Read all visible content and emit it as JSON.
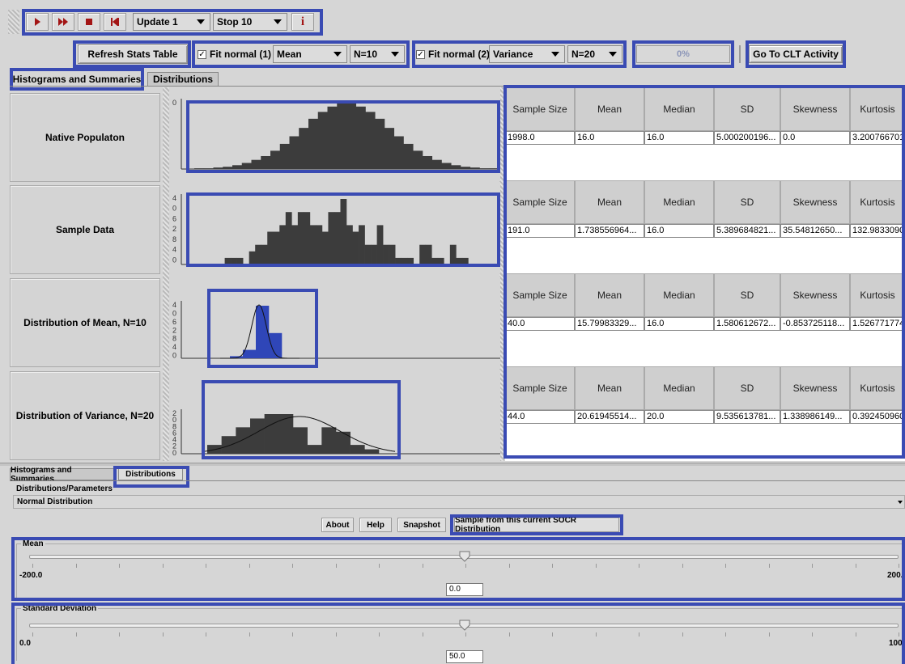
{
  "toolbar": {
    "update_combo": "Update 1",
    "stop_combo": "Stop 10",
    "info_label": "i",
    "refresh_label": "Refresh Stats Table",
    "fit1_label": "Fit normal (1)",
    "fit1_stat": "Mean",
    "fit1_n": "N=10",
    "fit2_label": "Fit normal (2)",
    "fit2_stat": "Variance",
    "fit2_n": "N=20",
    "progress_text": "0%",
    "progress_value": 0,
    "clt_label": "Go To CLT Activity"
  },
  "tabs": {
    "histograms": "Histograms and Summaries",
    "distributions": "Distributions"
  },
  "rows": [
    {
      "label": "Native Populaton"
    },
    {
      "label": "Sample Data"
    },
    {
      "label": "Distribution of Mean, N=10"
    },
    {
      "label": "Distribution of Variance, N=20"
    }
  ],
  "axis_ticks": {
    "row1": [
      "0"
    ],
    "row2": [
      "4",
      "0",
      "6",
      "2",
      "8",
      "4",
      "0"
    ],
    "row3": [
      "4",
      "0",
      "6",
      "2",
      "8",
      "4",
      "0"
    ],
    "row4": [
      "2",
      "0",
      "8",
      "6",
      "4",
      "2",
      "0"
    ]
  },
  "stats": {
    "headers": [
      "Sample Size",
      "Mean",
      "Median",
      "SD",
      "Skewness",
      "Kurtosis"
    ],
    "rows": [
      [
        "1998.0",
        "16.0",
        "16.0",
        "5.000200196...",
        "0.0",
        "3.200766701"
      ],
      [
        "191.0",
        "1.738556964...",
        "16.0",
        "5.389684821...",
        "35.54812650...",
        "132.9833090"
      ],
      [
        "40.0",
        "15.79983329...",
        "16.0",
        "1.580612672...",
        "-0.853725118...",
        "1.526771774"
      ],
      [
        "44.0",
        "20.61945514...",
        "20.0",
        "9.535613781...",
        "1.338986149...",
        "0.392450960"
      ]
    ]
  },
  "bottom": {
    "tab_histograms": "Histograms and Summaries",
    "tab_distributions": "Distributions",
    "params_label": "Distributions/Parameters",
    "dist_select": "Normal Distribution",
    "about": "About",
    "help": "Help",
    "snapshot": "Snapshot",
    "sample_btn": "Sample from this current SOCR Distribution",
    "mean_label": "Mean",
    "mean_min": "-200.0",
    "mean_max": "200.",
    "mean_value": "0.0",
    "sd_label": "Standard Deviation",
    "sd_min": "0.0",
    "sd_max": "100.",
    "sd_value": "50.0"
  },
  "colors": {
    "highlight": "#3a4bb3",
    "bar": "#3c3c3c",
    "blue_bar": "#2f46b8"
  },
  "chart_data": [
    {
      "type": "bar",
      "name_hint": "native",
      "values": [
        1,
        1,
        2,
        3,
        5,
        8,
        12,
        17,
        24,
        33,
        43,
        54,
        66,
        75,
        82,
        86,
        86,
        82,
        75,
        66,
        54,
        43,
        33,
        24,
        17,
        12,
        8,
        5,
        3,
        2,
        1,
        1
      ]
    },
    {
      "type": "bar",
      "name_hint": "sample",
      "values": [
        0,
        0,
        0,
        0,
        0,
        1,
        1,
        1,
        0,
        2,
        3,
        3,
        5,
        5,
        6,
        8,
        6,
        8,
        8,
        6,
        6,
        5,
        8,
        8,
        10,
        6,
        5,
        6,
        3,
        3,
        6,
        3,
        3,
        1,
        1,
        1,
        0,
        3,
        3,
        1,
        1,
        0,
        3,
        1,
        1,
        0,
        0,
        0,
        0,
        0
      ]
    },
    {
      "type": "bar",
      "name_hint": "mean",
      "values": [
        1,
        4,
        25,
        12
      ]
    },
    {
      "type": "bar",
      "name_hint": "variance",
      "values": [
        2,
        4,
        6,
        8,
        9,
        9,
        6,
        2,
        6,
        5,
        2,
        1
      ]
    }
  ]
}
